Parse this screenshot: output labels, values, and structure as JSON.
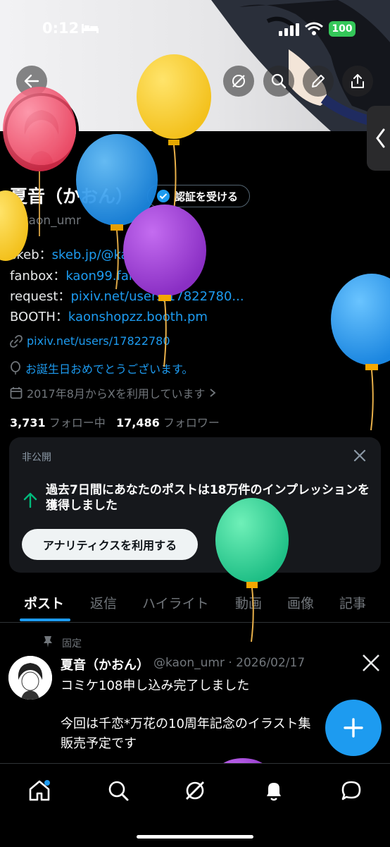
{
  "status_bar": {
    "time": "0:12",
    "battery": "100"
  },
  "profile": {
    "name": "夏音（かおん）",
    "verify_button": "認証を受ける",
    "handle": "@kaon_umr",
    "bio": [
      {
        "label": "skeb：",
        "link": "skeb.jp/@kaon_umr"
      },
      {
        "label": "fanbox：",
        "link": "kaon99.fanbox.cc"
      },
      {
        "label": "request：",
        "link": "pixiv.net/users/17822780..."
      },
      {
        "label": "BOOTH：",
        "link": "kaonshopzz.booth.pm"
      }
    ],
    "website": "pixiv.net/users/17822780",
    "birthday": "お誕生日おめでとうございます。",
    "joined": "2017年8月からXを利用しています",
    "following_count": "3,731",
    "following_label": "フォロー中",
    "followers_count": "17,486",
    "followers_label": "フォロワー"
  },
  "private_card": {
    "title": "非公開",
    "message": "過去7日間にあなたのポストは18万件のインプレッションを獲得しました",
    "button": "アナリティクスを利用する"
  },
  "tabs": [
    "ポスト",
    "返信",
    "ハイライト",
    "動画",
    "画像",
    "記事"
  ],
  "active_tab": "ポスト",
  "pinned_post": {
    "pinned_label": "固定",
    "author": "夏音（かおん）",
    "meta": "@kaon_umr · 2026/02/17",
    "lines": [
      "コミケ108申し込み完了しました",
      "",
      "今回は千恋*万花の10周年記念のイラスト集",
      "販売予定です"
    ]
  },
  "icons": {
    "back": "arrow-left-icon",
    "grok": "grok-icon",
    "search": "search-icon",
    "edit": "pencil-icon",
    "share": "share-icon",
    "link": "link-icon",
    "balloon": "balloon-icon",
    "calendar": "calendar-icon",
    "close": "close-icon",
    "arrow_up": "arrow-up-icon",
    "pin": "pin-icon",
    "x_logo": "x-logo-icon",
    "compose": "plus-icon",
    "home": "home-icon",
    "notifications": "bell-icon",
    "messages": "message-icon"
  },
  "colors": {
    "accent": "#1d9bf0",
    "background": "#000000",
    "muted": "#71767b",
    "success": "#00ba7c"
  }
}
